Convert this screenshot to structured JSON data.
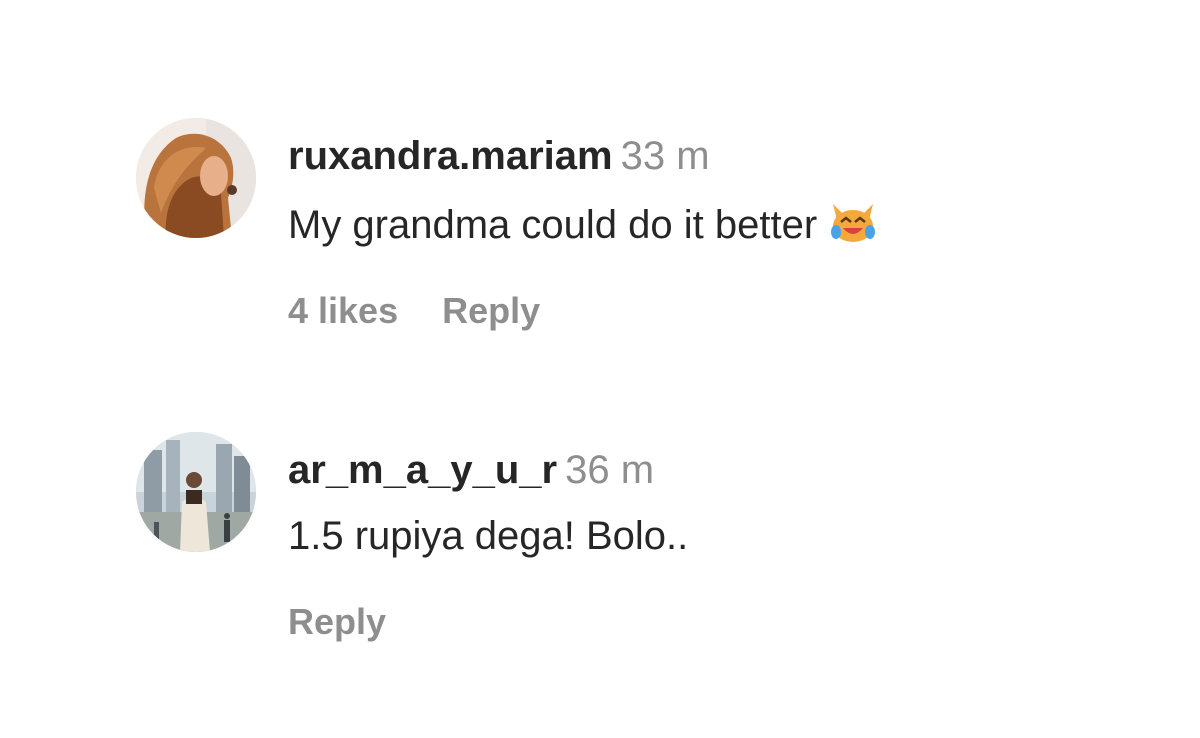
{
  "comments": [
    {
      "username": "ruxandra.mariam",
      "time": "33 m",
      "text": "My grandma could do it better",
      "emoji": "crying-laughing-cat-emoji",
      "likes": "4 likes",
      "reply": "Reply"
    },
    {
      "username": "ar_m_a_y_u_r",
      "time": "36 m",
      "text": "1.5 rupiya dega! Bolo..",
      "reply": "Reply"
    }
  ],
  "colors": {
    "primary_text": "#262626",
    "secondary_text": "#8e8e8e",
    "background": "#ffffff"
  }
}
